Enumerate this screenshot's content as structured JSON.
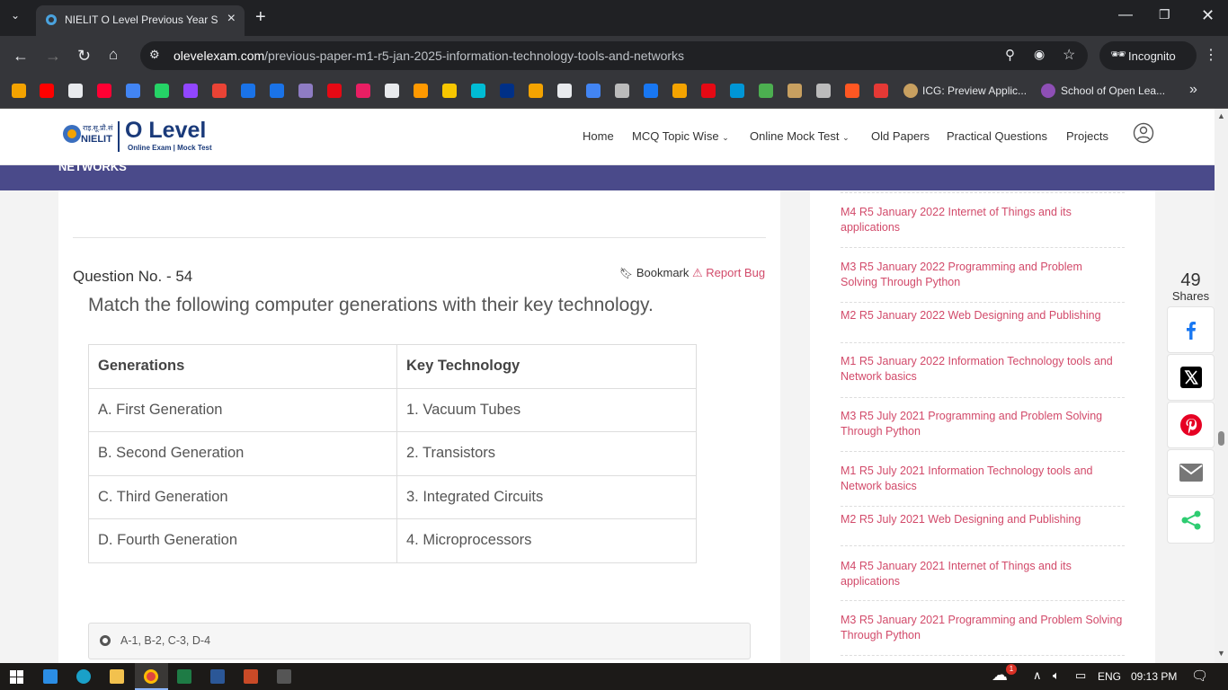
{
  "browser": {
    "tab_title": "NIELIT O Level Previous Year So",
    "url_host": "olevelexam.com",
    "url_path": "/previous-paper-m1-r5-jan-2025-information-technology-tools-and-networks",
    "incognito_label": "Incognito",
    "bookmarks": [
      {
        "icon": "jotform-icon",
        "color": "#f4a300"
      },
      {
        "icon": "youtube-icon",
        "color": "#ff0000"
      },
      {
        "icon": "threads-icon",
        "color": "#e8eaed"
      },
      {
        "icon": "youtube-music-icon",
        "color": "#ff0033"
      },
      {
        "icon": "google-icon",
        "color": "#4285f4"
      },
      {
        "icon": "whatsapp-icon",
        "color": "#25d366"
      },
      {
        "icon": "twitch-icon",
        "color": "#9146ff"
      },
      {
        "icon": "gmail-icon",
        "color": "#ea4335"
      },
      {
        "icon": "play-icon",
        "color": "#1a73e8"
      },
      {
        "icon": "play-icon",
        "color": "#1a73e8"
      },
      {
        "icon": "circle-icon",
        "color": "#8e7cc3"
      },
      {
        "icon": "netflix-icon",
        "color": "#e50914"
      },
      {
        "icon": "gift-icon",
        "color": "#e91e63"
      },
      {
        "icon": "game-icon",
        "color": "#e8eaed"
      },
      {
        "icon": "amazon-icon",
        "color": "#ff9900"
      },
      {
        "icon": "flipkart-icon",
        "color": "#f7c600"
      },
      {
        "icon": "check-icon",
        "color": "#00bcd4"
      },
      {
        "icon": "paypal-icon",
        "color": "#003087"
      },
      {
        "icon": "grammarly-g-icon",
        "color": "#f4a300"
      },
      {
        "icon": "olx-icon",
        "color": "#e8eaed"
      },
      {
        "icon": "translate-icon",
        "color": "#4285f4"
      },
      {
        "icon": "photo-icon",
        "color": "#bbbbbb"
      },
      {
        "icon": "facebook-icon",
        "color": "#1877f2"
      },
      {
        "icon": "person-icon",
        "color": "#f4a300"
      },
      {
        "icon": "ns-icon",
        "color": "#e50914"
      },
      {
        "icon": "hp-icon",
        "color": "#0096d6"
      },
      {
        "icon": "leaf-icon",
        "color": "#4caf50"
      },
      {
        "icon": "emblem-icon",
        "color": "#c8a060"
      },
      {
        "icon": "seal-icon",
        "color": "#bbbbbb"
      },
      {
        "icon": "x-letter-icon",
        "color": "#ff5722"
      },
      {
        "icon": "huawei-icon",
        "color": "#e53935"
      }
    ],
    "bookmark_labels": [
      "ICG: Preview Applic...",
      "School of Open Lea..."
    ]
  },
  "site": {
    "logo_title": "O Level",
    "logo_subtitle": "Online Exam | Mock Test",
    "logo_hindi": "राइ.सू.प्रौ.सं",
    "logo_nielit": "NIELIT",
    "band_text": "NETWORKS",
    "nav": [
      "Home",
      "MCQ Topic Wise",
      "Online Mock Test",
      "Old Papers",
      "Practical Questions",
      "Projects"
    ]
  },
  "question": {
    "number_label": "Question No. - 54",
    "bookmark_label": "Bookmark",
    "report_label": "Report Bug",
    "text": "Match the following computer generations with their key technology.",
    "table_headers": [
      "Generations",
      "Key Technology"
    ],
    "table_rows": [
      [
        "A. First Generation",
        "1. Vacuum Tubes"
      ],
      [
        "B. Second Generation",
        "2. Transistors"
      ],
      [
        "C. Third Generation",
        "3. Integrated Circuits"
      ],
      [
        "D. Fourth Generation",
        "4. Microprocessors"
      ]
    ],
    "option_1": "A-1, B-2, C-3, D-4"
  },
  "sidebar": {
    "links": [
      [
        "M4 R5 January 2022 Internet of Things and its",
        "applications"
      ],
      [
        "M3 R5 January 2022 Programming and Problem",
        "Solving Through Python"
      ],
      [
        "M2 R5 January 2022 Web Designing and Publishing"
      ],
      [
        "M1 R5 January 2022 Information Technology tools and",
        "Network basics"
      ],
      [
        "M3 R5 July 2021 Programming and Problem Solving",
        "Through Python"
      ],
      [
        "M1 R5 July 2021 Information Technology tools and",
        "Network basics"
      ],
      [
        "M2 R5 July 2021 Web Designing and Publishing"
      ],
      [
        "M4 R5 January 2021 Internet of Things and its",
        "applications"
      ],
      [
        "M3 R5 January 2021 Programming and Problem Solving",
        "Through Python"
      ]
    ]
  },
  "share": {
    "count": "49",
    "label": "Shares"
  },
  "taskbar": {
    "lang": "ENG",
    "time": "09:13 PM",
    "weather_badge": "1"
  },
  "colors": {
    "accent_pink": "#d24a6a",
    "band": "#4a4a8a",
    "logo_blue": "#1a3a7a"
  }
}
